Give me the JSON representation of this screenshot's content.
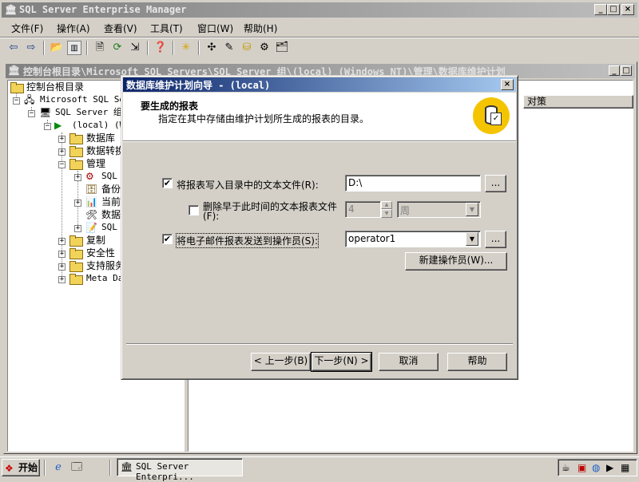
{
  "main_window": {
    "title": "SQL Server Enterprise Manager",
    "menu": [
      "文件(F)",
      "操作(A)",
      "查看(V)",
      "工具(T)",
      "窗口(W)",
      "帮助(H)"
    ]
  },
  "console": {
    "title": "控制台根目录\\Microsoft SQL Servers\\SQL Server 组\\(local) (Windows NT)\\管理\\数据库维护计划",
    "column_header": "对策",
    "tree": {
      "root": "控制台根目录",
      "servers": "Microsoft SQL Ser",
      "group": "SQL Server 组",
      "local": "(local) (W",
      "databases": "数据库",
      "dts": "数据转换",
      "management": "管理",
      "mgmt_sql_agent": "SQL",
      "mgmt_backup": "备份",
      "mgmt_current": "当前",
      "mgmt_db_maint": "数据",
      "mgmt_sql_logs": "SQL",
      "replication": "复制",
      "security": "安全性",
      "support": "支持服务",
      "meta": "Meta Da"
    }
  },
  "wizard": {
    "title": "数据库维护计划向导 - (local)",
    "heading": "要生成的报表",
    "subheading": "指定在其中存储由维护计划所生成的报表的目录。",
    "write_report_label": "将报表写入目录中的文本文件(R):",
    "write_report_checked": true,
    "report_dir": "D:\\",
    "browse_label": "...",
    "delete_older_label_1": "删除早于此时间的文本报表文件",
    "delete_older_label_2": "(F):",
    "delete_older_checked": false,
    "delete_num": "4",
    "delete_unit": "周",
    "email_label": "将电子邮件报表发送到操作员(S):",
    "email_checked": true,
    "operator": "operator1",
    "operator_browse_label": "...",
    "new_operator_label": "新建操作员(W)...",
    "back_label": "< 上一步(B)",
    "next_label": "下一步(N) >",
    "cancel_label": "取消",
    "help_label": "帮助"
  },
  "taskbar": {
    "start_label": "开始",
    "task_label": "SQL Server Enterpri..."
  }
}
